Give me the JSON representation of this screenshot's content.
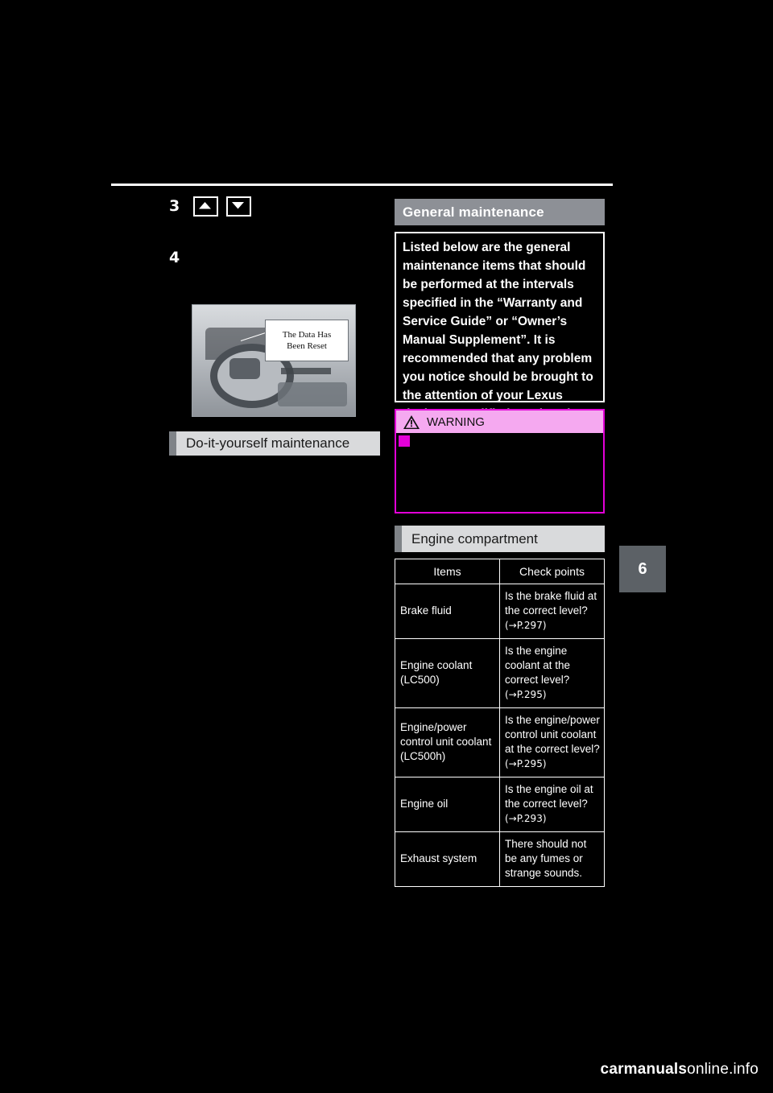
{
  "document": {
    "steps": [
      {
        "number": "3",
        "icons": [
          "chevron-up-icon",
          "chevron-down-icon"
        ]
      },
      {
        "number": "4"
      }
    ],
    "illustration": {
      "name": "steering-wheel-and-display-illustration",
      "display_lines": [
        "The Data Has",
        "Been Reset"
      ]
    },
    "left_section": {
      "heading": "Do-it-yourself maintenance"
    },
    "general_maintenance": {
      "heading": "General maintenance",
      "body": "Listed below are the general maintenance items that should be performed at the intervals specified in the “Warranty and Service Guide” or “Owner’s Manual Supplement”. It is recommended that any problem you notice should be brought to the attention of your Lexus dealer or qualified service shop for advice."
    },
    "warning": {
      "label": "WARNING",
      "icon": "warning-triangle-icon",
      "body": ""
    },
    "engine_compartment": {
      "heading": "Engine compartment",
      "columns": [
        "Items",
        "Check points"
      ],
      "rows": [
        {
          "item": "Brake fluid",
          "check": "Is the brake fluid at the correct level?",
          "reference": "(→P.297)"
        },
        {
          "item": "Engine coolant (LC500)",
          "check": "Is the engine coolant at the correct level?",
          "reference": "(→P.295)"
        },
        {
          "item": "Engine/power control unit coolant (LC500h)",
          "check": "Is the engine/power control unit coolant at the correct level?",
          "reference": "(→P.295)"
        },
        {
          "item": "Engine oil",
          "check": "Is the engine oil at the correct level?",
          "reference": "(→P.293)"
        },
        {
          "item": "Exhaust system",
          "check": "There should not be any fumes or strange sounds.",
          "reference": ""
        }
      ]
    },
    "side_tab": {
      "chapter_number": "6"
    },
    "footer": {
      "text_bold": "carmanuals",
      "text_rest": "online.info"
    }
  }
}
